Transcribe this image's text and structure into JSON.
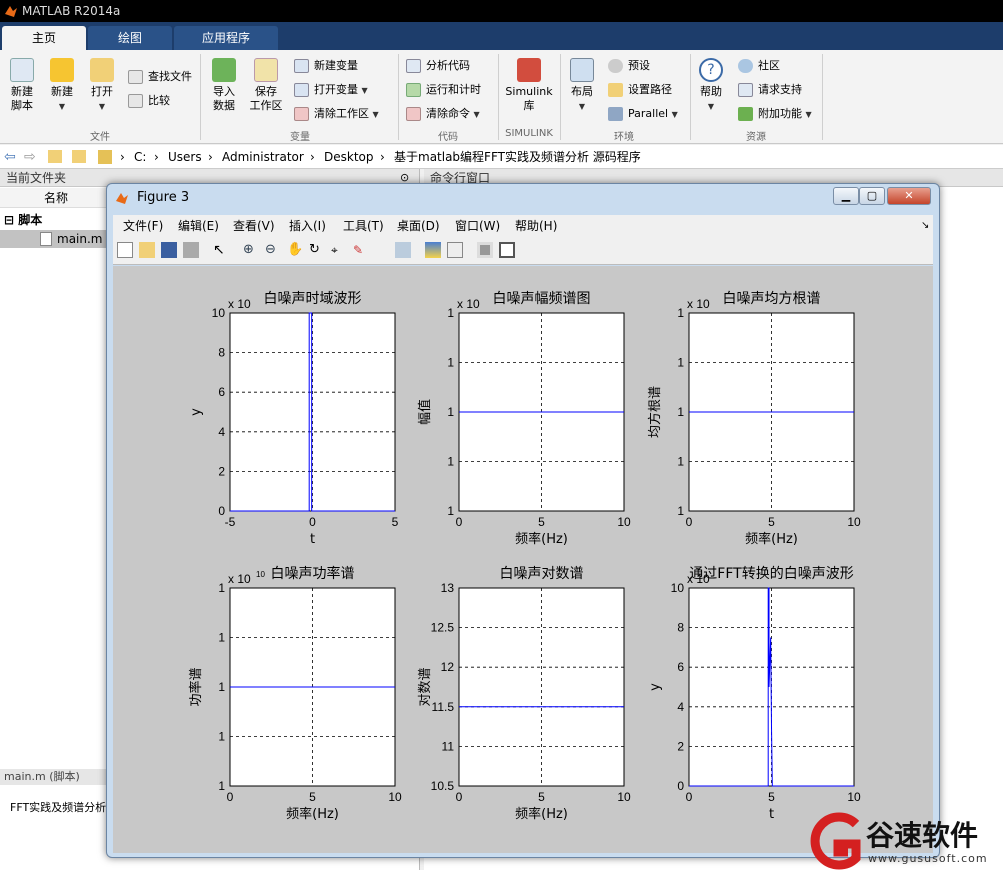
{
  "app": {
    "title": "MATLAB R2014a"
  },
  "tabs": [
    {
      "label": "主页"
    },
    {
      "label": "绘图"
    },
    {
      "label": "应用程序"
    }
  ],
  "ribbon": {
    "file": {
      "new_script": "新建\n脚本",
      "new": "新建",
      "open": "打开",
      "find_files": "查找文件",
      "compare": "比较",
      "group": "文件"
    },
    "variable": {
      "import": "导入\n数据",
      "save_ws": "保存\n工作区",
      "new_var": "新建变量",
      "open_var": "打开变量",
      "clear_ws": "清除工作区",
      "group": "变量"
    },
    "code": {
      "analyze": "分析代码",
      "run_time": "运行和计时",
      "clear_cmd": "清除命令",
      "group": "代码"
    },
    "simulink": {
      "lib": "Simulink\n库",
      "group": "SIMULINK"
    },
    "env": {
      "layout": "布局",
      "prefs": "预设",
      "set_path": "设置路径",
      "parallel": "Parallel",
      "group": "环境"
    },
    "res": {
      "help": "帮助",
      "community": "社区",
      "support": "请求支持",
      "addons": "附加功能",
      "group": "资源"
    }
  },
  "address": {
    "path": [
      "C:",
      "Users",
      "Administrator",
      "Desktop",
      "基于matlab编程FFT实践及频谱分析 源码程序"
    ]
  },
  "current_folder": {
    "title": "当前文件夹",
    "col_name": "名称",
    "group": "脚本",
    "file": "main.m",
    "detail_title": "main.m (脚本)",
    "detail_text": "FFT实践及频谱分析"
  },
  "command_window": {
    "title": "命令行窗口"
  },
  "figure": {
    "title": "Figure 3",
    "menu": [
      "文件(F)",
      "编辑(E)",
      "查看(V)",
      "插入(I)",
      "工具(T)",
      "桌面(D)",
      "窗口(W)",
      "帮助(H)"
    ]
  },
  "chart_data": [
    {
      "type": "line",
      "title": "白噪声时域波形",
      "xlabel": "t",
      "ylabel": "y",
      "exponent": "x 10",
      "xlim": [
        -5,
        5
      ],
      "ylim": [
        0,
        10
      ],
      "xticks": [
        "-5",
        "0",
        "5"
      ],
      "yticks": [
        "0",
        "2",
        "4",
        "6",
        "8",
        "10"
      ],
      "series": [
        {
          "x": [
            -5,
            -0.2,
            -0.2,
            -0.05,
            -0.05,
            0,
            0.1,
            5
          ],
          "y": [
            0,
            0,
            10,
            10,
            0,
            0,
            0,
            0
          ]
        }
      ],
      "color": "#0000ff"
    },
    {
      "type": "line",
      "title": "白噪声幅频谱图",
      "xlabel": "频率(Hz)",
      "ylabel": "幅值",
      "exponent": "x 10",
      "xlim": [
        0,
        10
      ],
      "ylim": [
        0,
        4
      ],
      "xticks": [
        "0",
        "5",
        "10"
      ],
      "yticks": [
        "1",
        "1",
        "1",
        "1",
        "1"
      ],
      "series": [
        {
          "x": [
            0,
            10
          ],
          "y": [
            2,
            2
          ]
        }
      ],
      "color": "#0000ff"
    },
    {
      "type": "line",
      "title": "白噪声均方根谱",
      "xlabel": "频率(Hz)",
      "ylabel": "均方根谱",
      "exponent": "x 10",
      "xlim": [
        0,
        10
      ],
      "ylim": [
        0,
        4
      ],
      "xticks": [
        "0",
        "5",
        "10"
      ],
      "yticks": [
        "1",
        "1",
        "1",
        "1",
        "1"
      ],
      "series": [
        {
          "x": [
            0,
            10
          ],
          "y": [
            2,
            2
          ]
        }
      ],
      "color": "#0000ff"
    },
    {
      "type": "line",
      "title": "白噪声功率谱",
      "xlabel": "频率(Hz)",
      "ylabel": "功率谱",
      "exponent": "x 10",
      "exp_sup": "10",
      "xlim": [
        0,
        10
      ],
      "ylim": [
        0,
        4
      ],
      "xticks": [
        "0",
        "5",
        "10"
      ],
      "yticks": [
        "1",
        "1",
        "1",
        "1",
        "1"
      ],
      "series": [
        {
          "x": [
            0,
            10
          ],
          "y": [
            2,
            2
          ]
        }
      ],
      "color": "#0000ff"
    },
    {
      "type": "line",
      "title": "白噪声对数谱",
      "xlabel": "频率(Hz)",
      "ylabel": "对数谱",
      "exponent": "",
      "xlim": [
        0,
        10
      ],
      "ylim": [
        10.5,
        13
      ],
      "xticks": [
        "0",
        "5",
        "10"
      ],
      "yticks": [
        "10.5",
        "11",
        "11.5",
        "12",
        "12.5",
        "13"
      ],
      "series": [
        {
          "x": [
            0,
            10
          ],
          "y": [
            11.5,
            11.5
          ]
        }
      ],
      "color": "#0000ff"
    },
    {
      "type": "line",
      "title": "通过FFT转换的白噪声波形",
      "xlabel": "t",
      "ylabel": "y",
      "exponent": "x 10",
      "xlim": [
        0,
        10
      ],
      "ylim": [
        0,
        10
      ],
      "xticks": [
        "0",
        "5",
        "10"
      ],
      "yticks": [
        "0",
        "2",
        "4",
        "6",
        "8",
        "10"
      ],
      "series": [
        {
          "x": [
            0,
            4.8,
            4.8,
            4.85,
            4.85,
            4.95,
            5,
            5.05,
            10
          ],
          "y": [
            0,
            0,
            10,
            10,
            5,
            7.5,
            3,
            0,
            0
          ]
        }
      ],
      "color": "#0000ff"
    }
  ],
  "watermark": {
    "brand": "谷速软件",
    "url": "www.gususoft.com"
  }
}
